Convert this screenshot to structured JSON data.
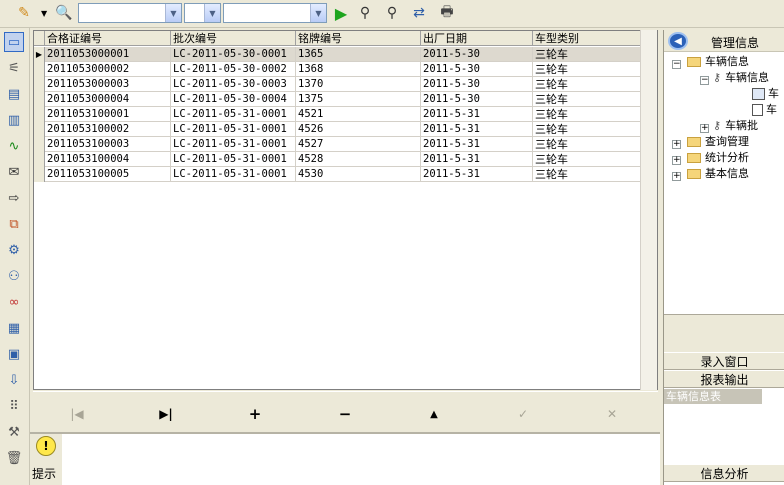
{
  "toolbar": {
    "icons": [
      "pencil-icon",
      "search-doc-icon",
      "run-icon",
      "find-icon",
      "find-next-icon",
      "replace-icon",
      "print-icon"
    ],
    "combo1_value": "",
    "combo2_value": "",
    "combo3_value": ""
  },
  "leftbar": {
    "icons": [
      "grid-view-icon",
      "tree-flow-icon",
      "form-icon",
      "document-icon",
      "chart-icon",
      "envelope-icon",
      "export-icon",
      "merge-icon",
      "settings-icon",
      "users-icon",
      "link-icon",
      "report-icon",
      "print-doc-icon",
      "import-icon",
      "apps-icon",
      "tools-icon",
      "trash-icon"
    ]
  },
  "grid": {
    "columns": [
      "合格证编号",
      "批次编号",
      "铭牌编号",
      "出厂日期",
      "车型类别"
    ],
    "rows": [
      [
        "2011053000001",
        "LC-2011-05-30-0001",
        "1365",
        "2011-5-30",
        "三轮车"
      ],
      [
        "2011053000002",
        "LC-2011-05-30-0002",
        "1368",
        "2011-5-30",
        "三轮车"
      ],
      [
        "2011053000003",
        "LC-2011-05-30-0003",
        "1370",
        "2011-5-30",
        "三轮车"
      ],
      [
        "2011053000004",
        "LC-2011-05-30-0004",
        "1375",
        "2011-5-30",
        "三轮车"
      ],
      [
        "2011053100001",
        "LC-2011-05-31-0001",
        "4521",
        "2011-5-31",
        "三轮车"
      ],
      [
        "2011053100002",
        "LC-2011-05-31-0001",
        "4526",
        "2011-5-31",
        "三轮车"
      ],
      [
        "2011053100003",
        "LC-2011-05-31-0001",
        "4527",
        "2011-5-31",
        "三轮车"
      ],
      [
        "2011053100004",
        "LC-2011-05-31-0001",
        "4528",
        "2011-5-31",
        "三轮车"
      ],
      [
        "2011053100005",
        "LC-2011-05-31-0001",
        "4530",
        "2011-5-31",
        "三轮车"
      ]
    ]
  },
  "navigator": {
    "first": "|◀",
    "last": "▶|",
    "insert": "+",
    "delete": "−",
    "edit": "▲",
    "post": "✓",
    "cancel": "✕"
  },
  "hint": {
    "label": "提示"
  },
  "rightpanel": {
    "title": "管理信息",
    "tree": {
      "vehicle_info": "车辆信息",
      "vehicle_info_sub": "车辆信息",
      "leaf1": "车",
      "leaf2": "车",
      "batch": "车辆批",
      "query": "查询管理",
      "stats": "统计分析",
      "basic": "基本信息"
    },
    "section_entry": "录入窗口",
    "section_report": "报表输出",
    "selected_item": "车辆信息表",
    "section_analysis": "信息分析"
  }
}
